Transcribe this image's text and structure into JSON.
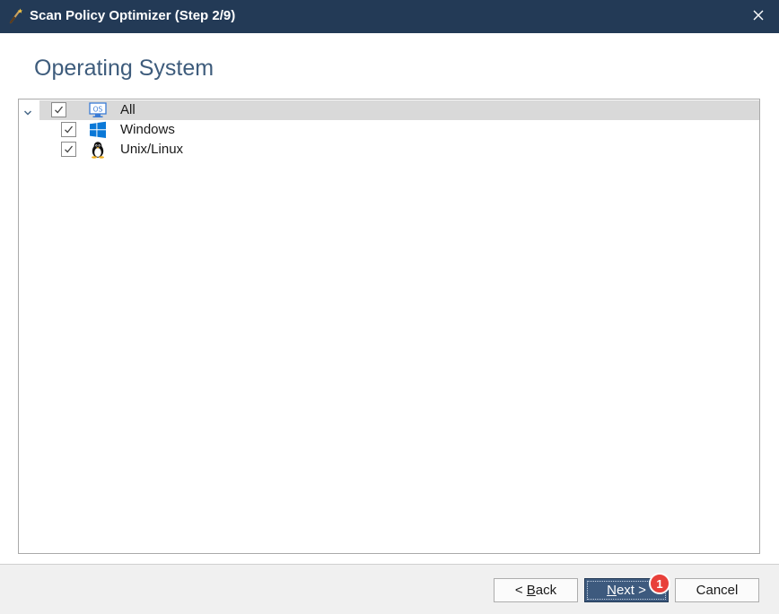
{
  "window": {
    "title": "Scan Policy Optimizer (Step 2/9)",
    "close_symbol": "✕",
    "title_icon": "magic-wand-icon"
  },
  "page": {
    "heading": "Operating System"
  },
  "tree": {
    "root": {
      "label": "All",
      "checked": true,
      "expanded": true,
      "icon": "os-monitor-icon",
      "icon_text": "OS"
    },
    "children": [
      {
        "label": "Windows",
        "checked": true,
        "icon": "windows-logo-icon"
      },
      {
        "label": "Unix/Linux",
        "checked": true,
        "icon": "linux-penguin-icon"
      }
    ]
  },
  "footer": {
    "back": {
      "mnemonic": "B",
      "prefix": "< ",
      "rest": "ack"
    },
    "next": {
      "mnemonic": "N",
      "rest": "ext >"
    },
    "cancel": "Cancel",
    "step_badge": "1"
  },
  "colors": {
    "titlebar": "#233a56",
    "heading": "#3e5c7c",
    "primary_button": "#3d5a7e",
    "badge": "#e8403a",
    "selected_row": "#d9d9d9"
  }
}
